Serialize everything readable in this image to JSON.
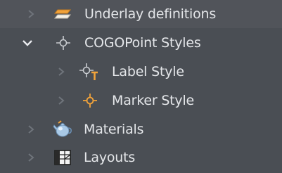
{
  "tree": {
    "items": [
      {
        "label": "Underlay definitions",
        "icon": "underlay-layers-icon",
        "expanded": false
      },
      {
        "label": "COGOPoint Styles",
        "icon": "crosshair-point-icon",
        "expanded": true
      },
      {
        "label": "Label Style",
        "icon": "point-label-style-icon",
        "expanded": false
      },
      {
        "label": "Marker Style",
        "icon": "point-marker-style-icon",
        "expanded": false
      },
      {
        "label": "Materials",
        "icon": "materials-teapot-icon",
        "expanded": false
      },
      {
        "label": "Layouts",
        "icon": "layouts-grid-icon",
        "expanded": false
      }
    ]
  },
  "colors": {
    "background": "#4a4e54",
    "text": "#e4e6e9",
    "chevron_collapsed": "#6f747b",
    "chevron_expanded": "#e8eaed",
    "accent_orange": "#f2a33a"
  }
}
